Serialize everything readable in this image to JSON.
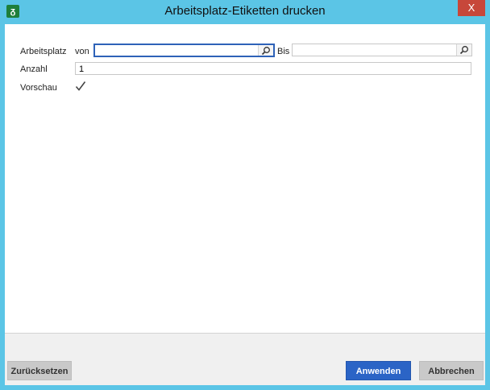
{
  "window": {
    "title": "Arbeitsplatz-Etiketten drucken",
    "close_glyph": "X"
  },
  "form": {
    "arbeitsplatz_label": "Arbeitsplatz",
    "von_label": "von",
    "von_value": "",
    "bis_label": "Bis",
    "bis_value": "",
    "anzahl_label": "Anzahl",
    "anzahl_value": "1",
    "vorschau_label": "Vorschau",
    "vorschau_checked": true
  },
  "footer": {
    "reset_label": "Zurücksetzen",
    "apply_label": "Anwenden",
    "cancel_label": "Abbrechen"
  },
  "icons": {
    "app": "app-icon",
    "search": "search-icon",
    "check": "check-icon"
  },
  "colors": {
    "frame": "#5bc5e6",
    "close": "#c7473a",
    "primary_button": "#2b64c6"
  }
}
